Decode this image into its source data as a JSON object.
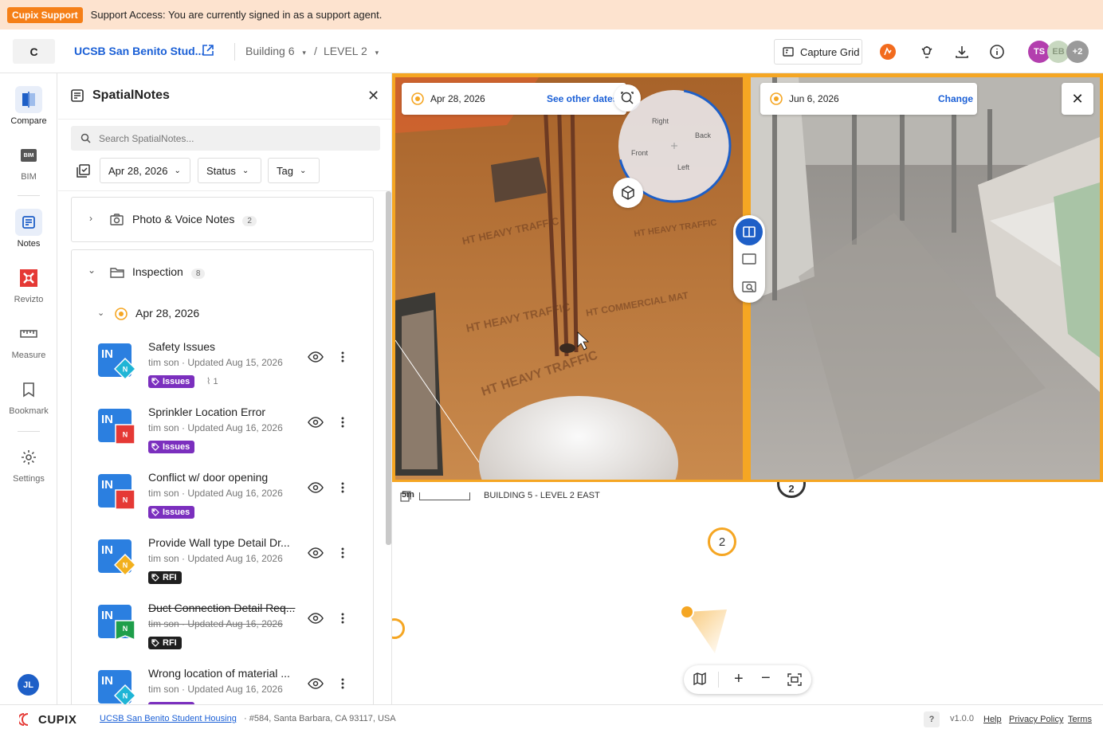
{
  "banner": {
    "badge": "Cupix Support",
    "message": "Support Access: You are currently signed in as a support agent."
  },
  "topbar": {
    "logo": "C",
    "project": "UCSB San Benito Stud...",
    "building": "Building 6",
    "separator": "/",
    "level": "LEVEL 2",
    "capture_grid": "Capture Grid",
    "avatars": [
      {
        "initials": "TS",
        "color": "#b33fae"
      },
      {
        "initials": "EB",
        "color": "#c8d8c0"
      },
      {
        "initials": "+2",
        "color": "#9a9a9a"
      }
    ]
  },
  "nav": {
    "items": [
      {
        "label": "Compare",
        "icon": "compare-icon"
      },
      {
        "label": "BIM",
        "icon": "bim-icon"
      },
      {
        "label": "Notes",
        "icon": "notes-icon"
      },
      {
        "label": "Revizto",
        "icon": "revizto-icon"
      },
      {
        "label": "Measure",
        "icon": "ruler-icon"
      },
      {
        "label": "Bookmark",
        "icon": "bookmark-icon"
      },
      {
        "label": "Settings",
        "icon": "gear-icon"
      }
    ],
    "user": "JL"
  },
  "panel": {
    "title": "SpatialNotes",
    "search_placeholder": "Search SpatialNotes...",
    "filters": {
      "date": "Apr 28, 2026",
      "status": "Status",
      "tag": "Tag"
    },
    "groups": [
      {
        "name": "Photo & Voice Notes",
        "count": "2"
      },
      {
        "name": "Inspection",
        "count": "8"
      }
    ],
    "subgroup_date": "Apr 28, 2026",
    "notes": [
      {
        "title": "Safety Issues",
        "meta": "tim son · Updated Aug 15, 2026",
        "tag": "Issues",
        "attachments": "1",
        "overlay_color": "#1fb5d6",
        "overlay_shape": "diamond"
      },
      {
        "title": "Sprinkler Location Error",
        "meta": "tim son · Updated Aug 16, 2026",
        "tag": "Issues",
        "overlay_color": "#e53935",
        "overlay_shape": "square"
      },
      {
        "title": "Conflict w/ door opening",
        "meta": "tim son · Updated Aug 16, 2026",
        "tag": "Issues",
        "overlay_color": "#e53935",
        "overlay_shape": "square"
      },
      {
        "title": "Provide Wall type Detail Dr...",
        "meta": "tim son · Updated Aug 16, 2026",
        "tag": "RFI",
        "overlay_color": "#f2b01e",
        "overlay_shape": "diamond"
      },
      {
        "title": "Duct Connection Detail Req...",
        "meta": "tim son · Updated Aug 16, 2026",
        "tag": "RFI",
        "overlay_color": "#1e9e4a",
        "overlay_shape": "flag"
      },
      {
        "title": "Wrong location of material ...",
        "meta": "tim son · Updated Aug 16, 2026",
        "tag": "Issues",
        "overlay_color": "#1fb5d6",
        "overlay_shape": "diamond"
      }
    ],
    "tag_colors": {
      "Issues": "#7b2fbe",
      "RFI": "#1f1f1f"
    },
    "note_initials": "IN",
    "note_badge": "N"
  },
  "viewer": {
    "left_date": "Apr 28, 2026",
    "left_link": "See other dates",
    "right_date": "Jun 6, 2026",
    "right_link": "Change",
    "compass": {
      "right": "Right",
      "back": "Back",
      "front": "Front",
      "left": "Left"
    },
    "accent": "#f5a623"
  },
  "map": {
    "scale": "5m",
    "floor": "BUILDING 5 - LEVEL 2 EAST",
    "marker_number": "2",
    "top_marker": "2"
  },
  "footer": {
    "brand": "CUPIX",
    "project_link": "UCSB San Benito Student Housing",
    "address": "#584, Santa Barbara, CA 93117, USA",
    "help_q": "?",
    "version": "v1.0.0",
    "help": "Help",
    "privacy": "Privacy Policy",
    "terms": "Terms"
  }
}
